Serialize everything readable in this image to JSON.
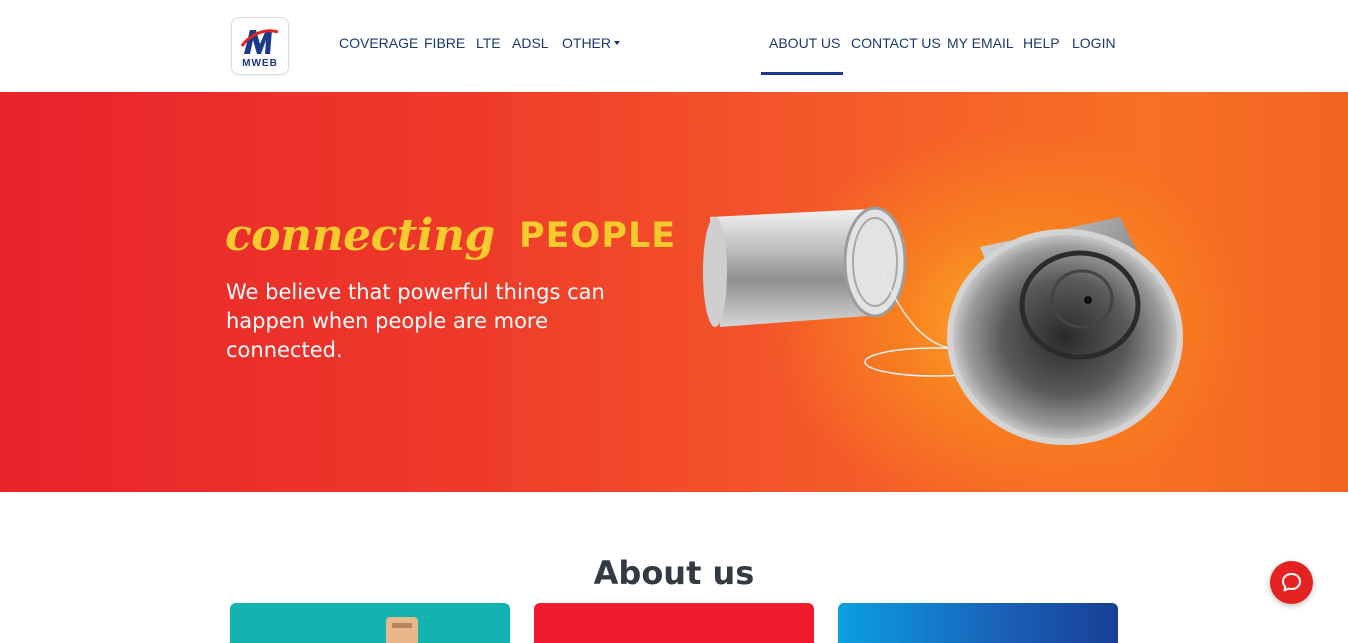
{
  "brand": {
    "logo_text": "MWEB",
    "primary_color": "#1b3a8c",
    "accent_color": "#e52222"
  },
  "nav": {
    "left": [
      {
        "label": "COVERAGE"
      },
      {
        "label": "FIBRE"
      },
      {
        "label": "LTE"
      },
      {
        "label": "ADSL"
      },
      {
        "label": "OTHER",
        "has_dropdown": true
      }
    ],
    "right": [
      {
        "label": "ABOUT US",
        "active": true
      },
      {
        "label": "CONTACT US"
      },
      {
        "label": "MY EMAIL"
      },
      {
        "label": "HELP"
      },
      {
        "label": "LOGIN"
      }
    ]
  },
  "hero": {
    "headline_script": "connecting",
    "headline_caps": "PEOPLE",
    "body": "We believe that powerful things can happen when people are more connected.",
    "headline_color": "#f7cb2d",
    "image": "tin-can-telephone"
  },
  "about": {
    "title": "About us",
    "cards": [
      {
        "color": "#14b3b2"
      },
      {
        "color": "#ee1c2c"
      },
      {
        "color": "#0aa0e0"
      }
    ]
  },
  "chat": {
    "icon": "chat-bubble-icon"
  }
}
